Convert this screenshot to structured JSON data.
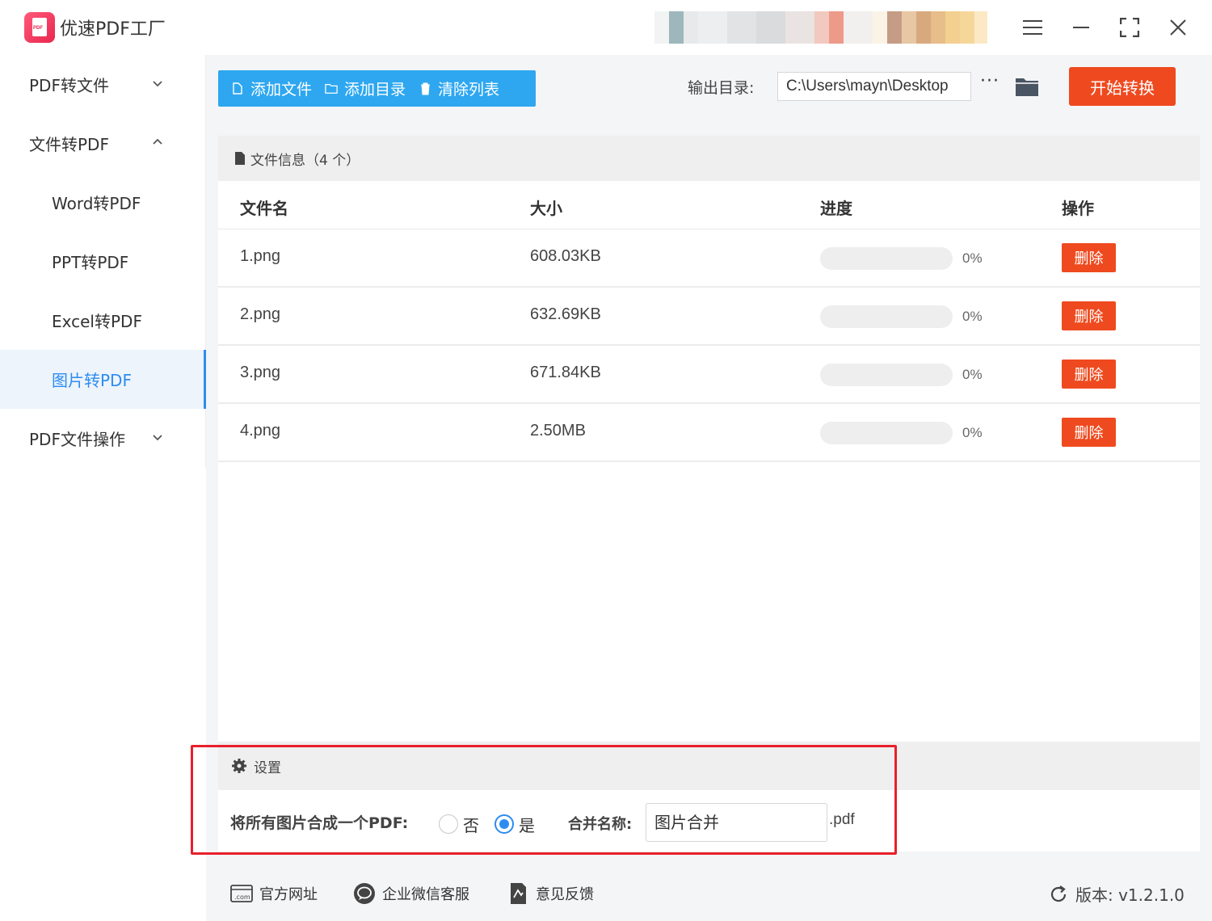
{
  "app": {
    "title": "优速PDF工厂",
    "logo_text": "PDF"
  },
  "window_controls": {
    "menu_icon": "menu-icon",
    "minimize_icon": "minimize-icon",
    "maximize_icon": "maximize-icon",
    "close_icon": "close-icon"
  },
  "sidebar": {
    "items": [
      {
        "label": "PDF转文件",
        "expanded": false
      },
      {
        "label": "文件转PDF",
        "expanded": true
      },
      {
        "label": "Word转PDF"
      },
      {
        "label": "PPT转PDF"
      },
      {
        "label": "Excel转PDF"
      },
      {
        "label": "图片转PDF",
        "active": true
      },
      {
        "label": "PDF文件操作",
        "expanded": false
      }
    ]
  },
  "toolbar": {
    "add_file": "添加文件",
    "add_folder": "添加目录",
    "clear_list": "清除列表",
    "output_label": "输出目录:",
    "output_path": "C:\\Users\\mayn\\Desktop",
    "more": "···",
    "start": "开始转换"
  },
  "file_panel": {
    "header": "文件信息（4 个）",
    "columns": [
      "文件名",
      "大小",
      "进度",
      "操作"
    ],
    "rows": [
      {
        "name": "1.png",
        "size": "608.03KB",
        "progress": 0,
        "progress_text": "0%",
        "action": "删除"
      },
      {
        "name": "2.png",
        "size": "632.69KB",
        "progress": 0,
        "progress_text": "0%",
        "action": "删除"
      },
      {
        "name": "3.png",
        "size": "671.84KB",
        "progress": 0,
        "progress_text": "0%",
        "action": "删除"
      },
      {
        "name": "4.png",
        "size": "2.50MB",
        "progress": 0,
        "progress_text": "0%",
        "action": "删除"
      }
    ]
  },
  "settings": {
    "header": "设置",
    "merge_label": "将所有图片合成一个PDF:",
    "option_no": "否",
    "option_yes": "是",
    "selected": "是",
    "name_label": "合并名称:",
    "name_value": "图片合并",
    "suffix": ".pdf"
  },
  "footer": {
    "website": "官方网址",
    "wechat": "企业微信客服",
    "feedback": "意见反馈",
    "version": "版本:  v1.2.1.0"
  },
  "colors": {
    "accent": "#2ea7f0",
    "danger": "#ef4a1f",
    "active_blue": "#2d8cf0",
    "highlight": "#e8202a"
  }
}
